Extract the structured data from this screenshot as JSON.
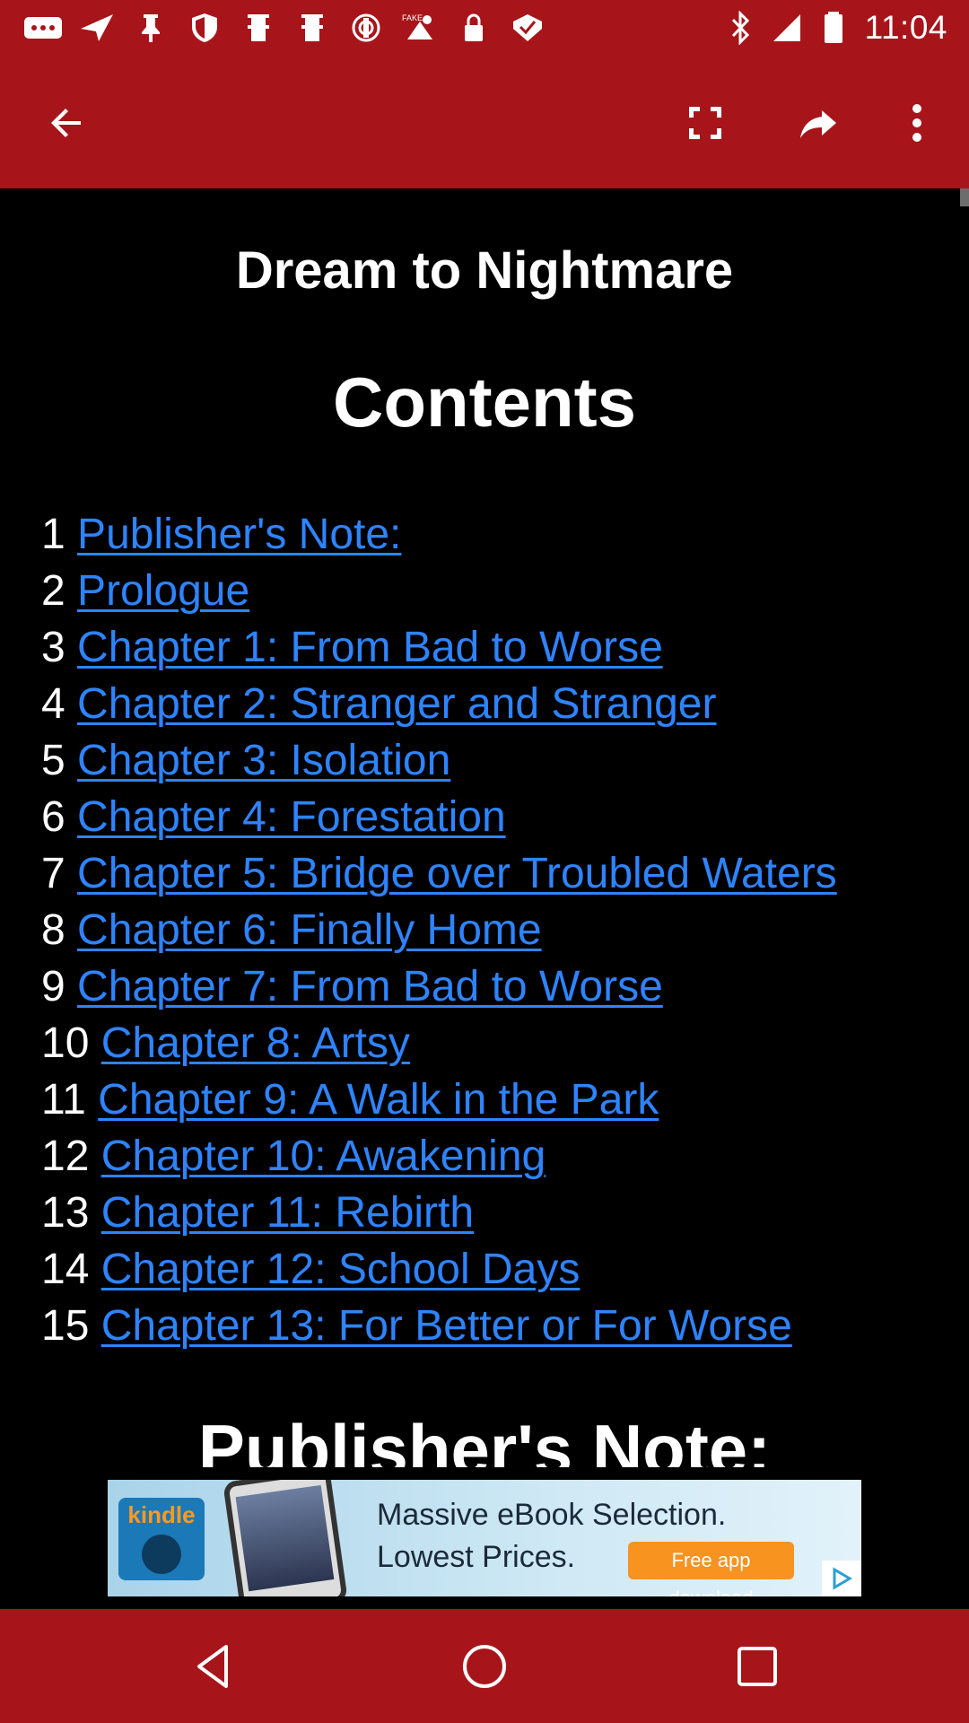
{
  "status_bar": {
    "time": "11:04",
    "left_icons": [
      "more-notifications-icon",
      "navigation-icon",
      "pin-icon",
      "shield-icon",
      "bookmark-icon",
      "bookmark-icon",
      "tracking-icon",
      "fake-gps-icon",
      "lock-icon",
      "checkbox-icon"
    ],
    "right_icons": [
      "bluetooth-icon",
      "signal-icon",
      "battery-icon"
    ]
  },
  "app_bar": {
    "back_icon": "back-arrow-icon",
    "fullscreen_icon": "fullscreen-icon",
    "share_icon": "share-forward-icon",
    "menu_icon": "more-vert-icon"
  },
  "book": {
    "title": "Dream to Nightmare",
    "contents_heading": "Contents",
    "next_section_heading": "Publisher's Note:"
  },
  "toc": [
    {
      "num": "1",
      "label": "Publisher's Note:"
    },
    {
      "num": "2",
      "label": "Prologue"
    },
    {
      "num": "3",
      "label": "Chapter 1: From Bad to Worse"
    },
    {
      "num": "4",
      "label": "Chapter 2: Stranger and Stranger"
    },
    {
      "num": "5",
      "label": "Chapter 3: Isolation"
    },
    {
      "num": "6",
      "label": "Chapter 4: Forestation"
    },
    {
      "num": "7",
      "label": "Chapter 5: Bridge over Troubled Waters"
    },
    {
      "num": "8",
      "label": "Chapter 6: Finally Home"
    },
    {
      "num": "9",
      "label": "Chapter 7: From Bad to Worse"
    },
    {
      "num": "10",
      "label": "Chapter 8: Artsy"
    },
    {
      "num": "11",
      "label": "Chapter 9: A Walk in the Park"
    },
    {
      "num": "12",
      "label": "Chapter 10: Awakening"
    },
    {
      "num": "13",
      "label": "Chapter 11: Rebirth"
    },
    {
      "num": "14",
      "label": "Chapter 12: School Days"
    },
    {
      "num": "15",
      "label": "Chapter 13: For Better or For Worse"
    }
  ],
  "ad": {
    "brand": "kindle",
    "line1": "Massive eBook Selection.",
    "line2": "Lowest Prices.",
    "cta": "Free app download",
    "choices_icon": "ad-choices-icon"
  },
  "nav_bar": {
    "back_icon": "nav-back-icon",
    "home_icon": "nav-home-icon",
    "recents_icon": "nav-recents-icon"
  },
  "colors": {
    "accent": "#a7151b",
    "link": "#2e84ff",
    "background": "#000000",
    "text": "#ffffff"
  }
}
